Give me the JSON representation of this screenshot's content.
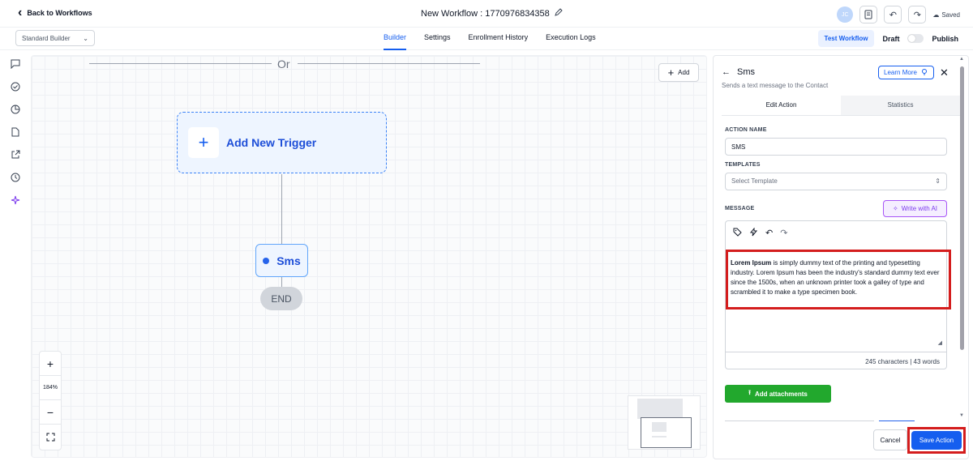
{
  "header": {
    "back_label": "Back to Workflows",
    "workflow_title": "New Workflow : 1770976834358",
    "avatar_initials": "JC",
    "saved_label": "Saved"
  },
  "subbar": {
    "builder_select": "Standard Builder",
    "tabs": [
      {
        "label": "Builder",
        "active": true
      },
      {
        "label": "Settings",
        "active": false
      },
      {
        "label": "Enrollment History",
        "active": false
      },
      {
        "label": "Execution Logs",
        "active": false
      }
    ],
    "test_workflow": "Test Workflow",
    "draft_label": "Draft",
    "publish_label": "Publish"
  },
  "canvas": {
    "or_label": "Or",
    "add_label": "Add",
    "trigger_label": "Add New Trigger",
    "sms_node_label": "Sms",
    "end_label": "END",
    "zoom_level": "184%"
  },
  "panel": {
    "title": "Sms",
    "subtitle": "Sends a text message to the Contact",
    "learn_more": "Learn More",
    "tabs": [
      "Edit Action",
      "Statistics"
    ],
    "action_name_label": "ACTION NAME",
    "action_name_value": "SMS",
    "templates_label": "TEMPLATES",
    "templates_placeholder": "Select Template",
    "message_label": "MESSAGE",
    "write_ai": "Write with AI",
    "message_bold": "Lorem Ipsum",
    "message_rest": " is simply dummy text of the printing and typesetting industry. Lorem Ipsum has been the industry's standard dummy text ever since the 1500s, when an unknown printer took a galley of type and scrambled it to make a type specimen book.",
    "char_count": "245 characters | 43 words",
    "add_attachments": "Add attachments",
    "cancel": "Cancel",
    "save_action": "Save Action"
  },
  "colors": {
    "accent": "#155eef",
    "highlight": "#d41d1d",
    "attach_green": "#22a82d"
  }
}
